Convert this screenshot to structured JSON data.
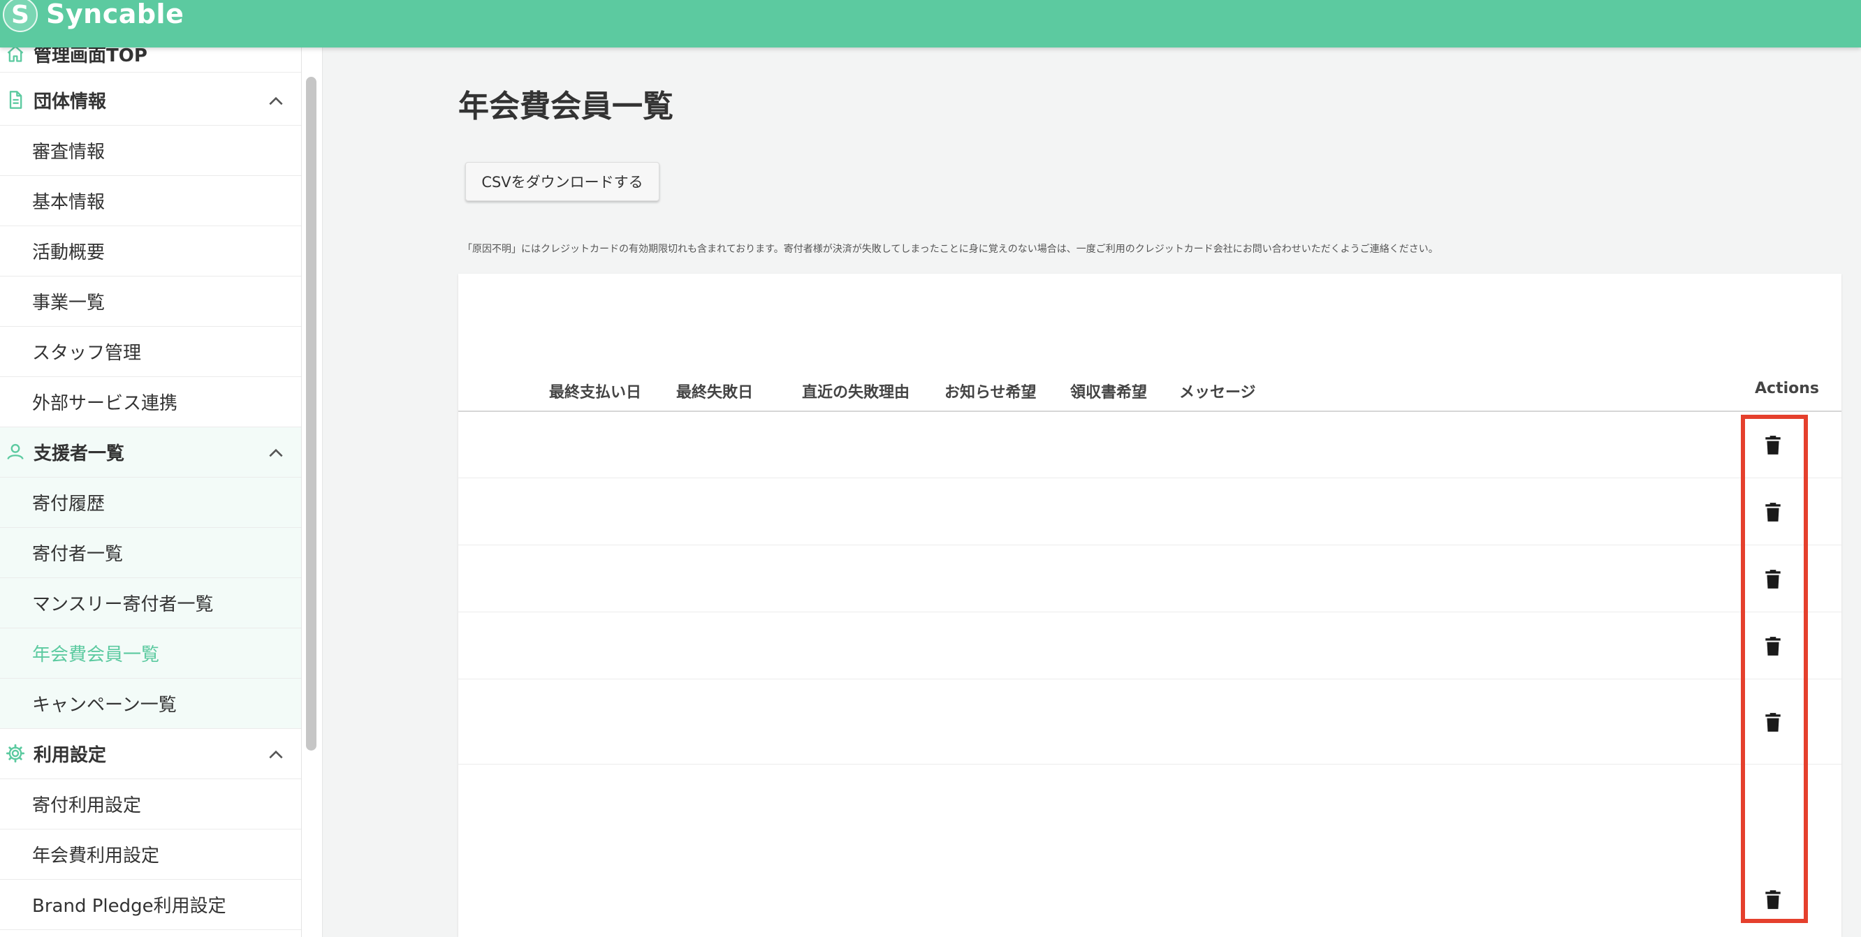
{
  "header": {
    "logo_letter": "S",
    "app_name": "Syncable",
    "brand_color": "#5ccaa0"
  },
  "sidebar": {
    "top_item": "管理画面TOP",
    "groups": [
      {
        "label": "団体情報",
        "icon": "document-icon",
        "items": [
          "審査情報",
          "基本情報",
          "活動概要",
          "事業一覧",
          "スタッフ管理",
          "外部サービス連携"
        ]
      },
      {
        "label": "支援者一覧",
        "icon": "person-icon",
        "items": [
          "寄付履歴",
          "寄付者一覧",
          "マンスリー寄付者一覧",
          "年会費会員一覧",
          "キャンペーン一覧"
        ]
      },
      {
        "label": "利用設定",
        "icon": "gear-icon",
        "items": [
          "寄付利用設定",
          "年会費利用設定",
          "Brand Pledge利用設定"
        ]
      }
    ],
    "active_item": "年会費会員一覧"
  },
  "main": {
    "title": "年会費会員一覧",
    "csv_button": "CSVをダウンロードする",
    "notice": "「原因不明」にはクレジットカードの有効期限切れも含まれております。寄付者様が決済が失敗してしまったことに身に覚えのない場合は、一度ご利用のクレジットカード会社にお問い合わせいただくようご連絡ください。",
    "table": {
      "columns": [
        "最終支払い日",
        "最終失敗日",
        "直近の失敗理由",
        "お知らせ希望",
        "領収書希望",
        "メッセージ"
      ],
      "actions_header": "Actions",
      "row_count": 6,
      "row_action_icon": "trash-icon"
    }
  },
  "colors": {
    "accent": "#5ccaa0",
    "highlight": "#e5402d"
  }
}
